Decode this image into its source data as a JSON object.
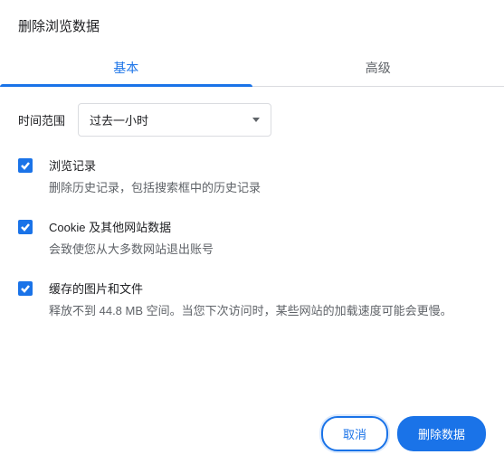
{
  "dialog": {
    "title": "删除浏览数据"
  },
  "tabs": {
    "basic": "基本",
    "advanced": "高级"
  },
  "timeRange": {
    "label": "时间范围",
    "selected": "过去一小时"
  },
  "options": [
    {
      "title": "浏览记录",
      "desc": "删除历史记录，包括搜索框中的历史记录"
    },
    {
      "title": "Cookie 及其他网站数据",
      "desc": "会致使您从大多数网站退出账号"
    },
    {
      "title": "缓存的图片和文件",
      "desc": "释放不到 44.8 MB 空间。当您下次访问时，某些网站的加载速度可能会更慢。"
    }
  ],
  "buttons": {
    "cancel": "取消",
    "confirm": "删除数据"
  }
}
